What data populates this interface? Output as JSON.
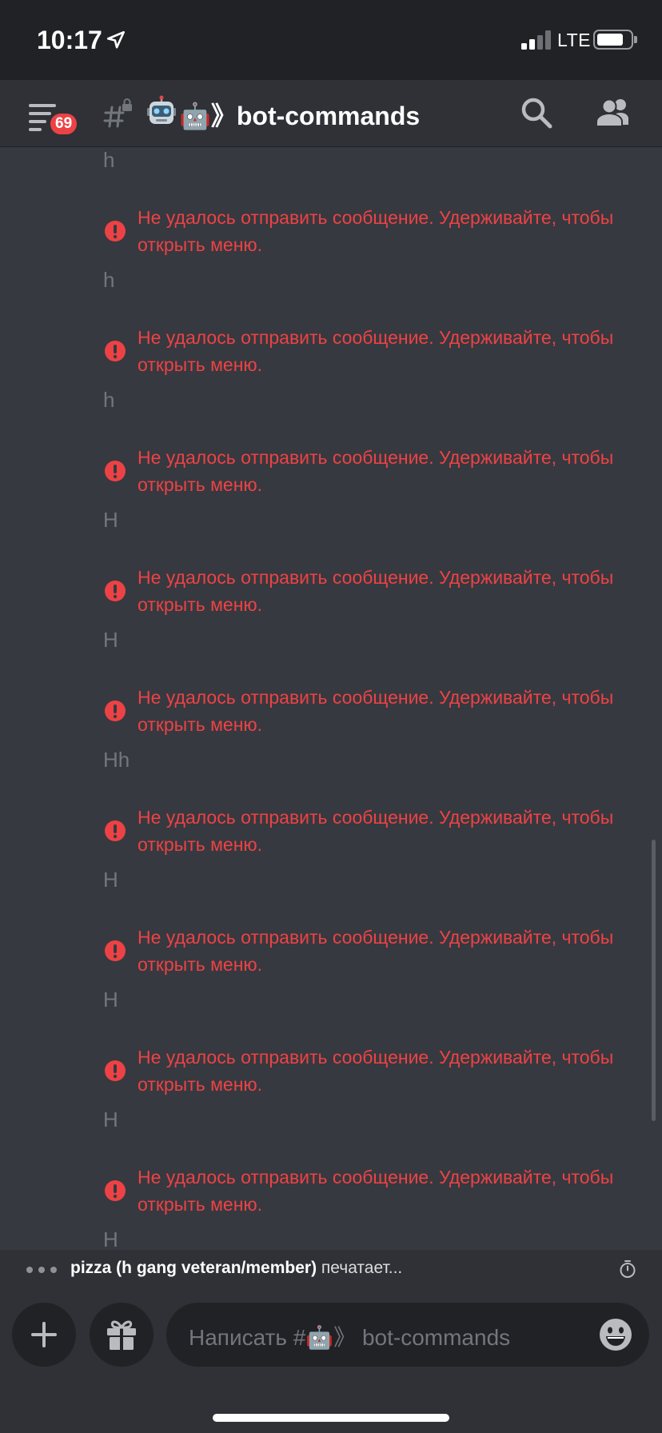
{
  "status_bar": {
    "time": "10:17",
    "network": "LTE",
    "icons": [
      "location-arrow-icon",
      "signal-bars-icon",
      "battery-icon"
    ]
  },
  "header": {
    "unread_badge": "69",
    "channel_name": "🤖》bot-commands",
    "icons": [
      "hamburger-menu-icon",
      "locked-channel-hash-icon",
      "robot-emoji-icon",
      "search-icon",
      "members-icon"
    ]
  },
  "messages": [
    {
      "text": "h",
      "error": "Не удалось отправить сообщение. Удерживайте, чтобы открыть меню.",
      "error_line1": "Не удалось отправить сообщение. Удерживайте, чтобы",
      "error_line2": "открыть меню."
    },
    {
      "text": "h",
      "error": "Не удалось отправить сообщение. Удерживайте, чтобы открыть меню.",
      "error_line1": "Не удалось отправить сообщение. Удерживайте, чтобы",
      "error_line2": "открыть меню."
    },
    {
      "text": "h",
      "error": "Не удалось отправить сообщение. Удерживайте, чтобы открыть меню.",
      "error_line1": "Не удалось отправить сообщение. Удерживайте, чтобы",
      "error_line2": "открыть меню."
    },
    {
      "text": "H",
      "error": "Не удалось отправить сообщение. Удерживайте, чтобы открыть меню.",
      "error_line1": "Не удалось отправить сообщение. Удерживайте, чтобы",
      "error_line2": "открыть меню."
    },
    {
      "text": "H",
      "error": "Не удалось отправить сообщение. Удерживайте, чтобы открыть меню.",
      "error_line1": "Не удалось отправить сообщение. Удерживайте, чтобы",
      "error_line2": "открыть меню."
    },
    {
      "text": "Hh",
      "error": "Не удалось отправить сообщение. Удерживайте, чтобы открыть меню.",
      "error_line1": "Не удалось отправить сообщение. Удерживайте, чтобы",
      "error_line2": "открыть меню."
    },
    {
      "text": "H",
      "error": "Не удалось отправить сообщение. Удерживайте, чтобы открыть меню.",
      "error_line1": "Не удалось отправить сообщение. Удерживайте, чтобы",
      "error_line2": "открыть меню."
    },
    {
      "text": "H",
      "error": "Не удалось отправить сообщение. Удерживайте, чтобы открыть меню.",
      "error_line1": "Не удалось отправить сообщение. Удерживайте, чтобы",
      "error_line2": "открыть меню."
    },
    {
      "text": "H",
      "error": "Не удалось отправить сообщение. Удерживайте, чтобы открыть меню.",
      "error_line1": "Не удалось отправить сообщение. Удерживайте, чтобы",
      "error_line2": "открыть меню."
    },
    {
      "text": "H",
      "error": "",
      "error_line1": "",
      "error_line2": ""
    }
  ],
  "typing": {
    "user": "pizza (h gang veteran/member)",
    "action": " печатает..."
  },
  "composer": {
    "placeholder": "Написать #🤖》 bot-commands",
    "icons": [
      "plus-icon",
      "gift-icon",
      "emoji-smile-icon"
    ]
  },
  "colors": {
    "background": "#36393f",
    "bars": "#2f3136",
    "error": "#ed4245",
    "muted_text": "#72767d"
  }
}
